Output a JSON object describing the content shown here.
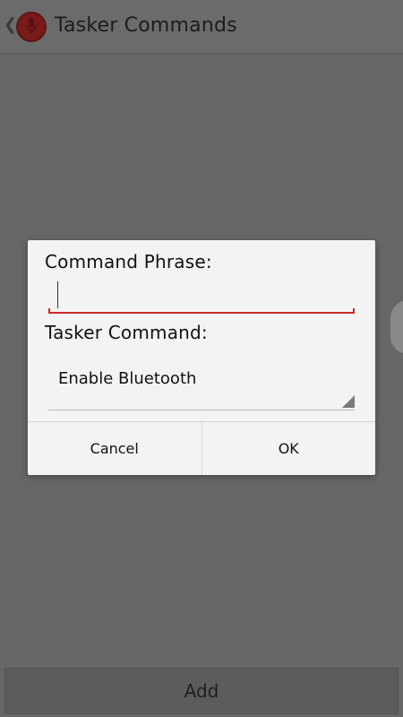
{
  "action_bar": {
    "title": "Tasker Commands",
    "app_icon": "microphone-icon",
    "up_icon": "chevron-left-icon"
  },
  "dialog": {
    "phrase_label": "Command Phrase:",
    "phrase_value": "",
    "command_label": "Tasker Command:",
    "command_selected": "Enable Bluetooth",
    "cancel_label": "Cancel",
    "ok_label": "OK"
  },
  "footer": {
    "add_label": "Add"
  },
  "colors": {
    "input_underline": "#cc2a2a",
    "app_icon_bg": "#7a1b1b",
    "dialog_bg": "#f3f3f3",
    "scrim_bg": "#676767"
  }
}
